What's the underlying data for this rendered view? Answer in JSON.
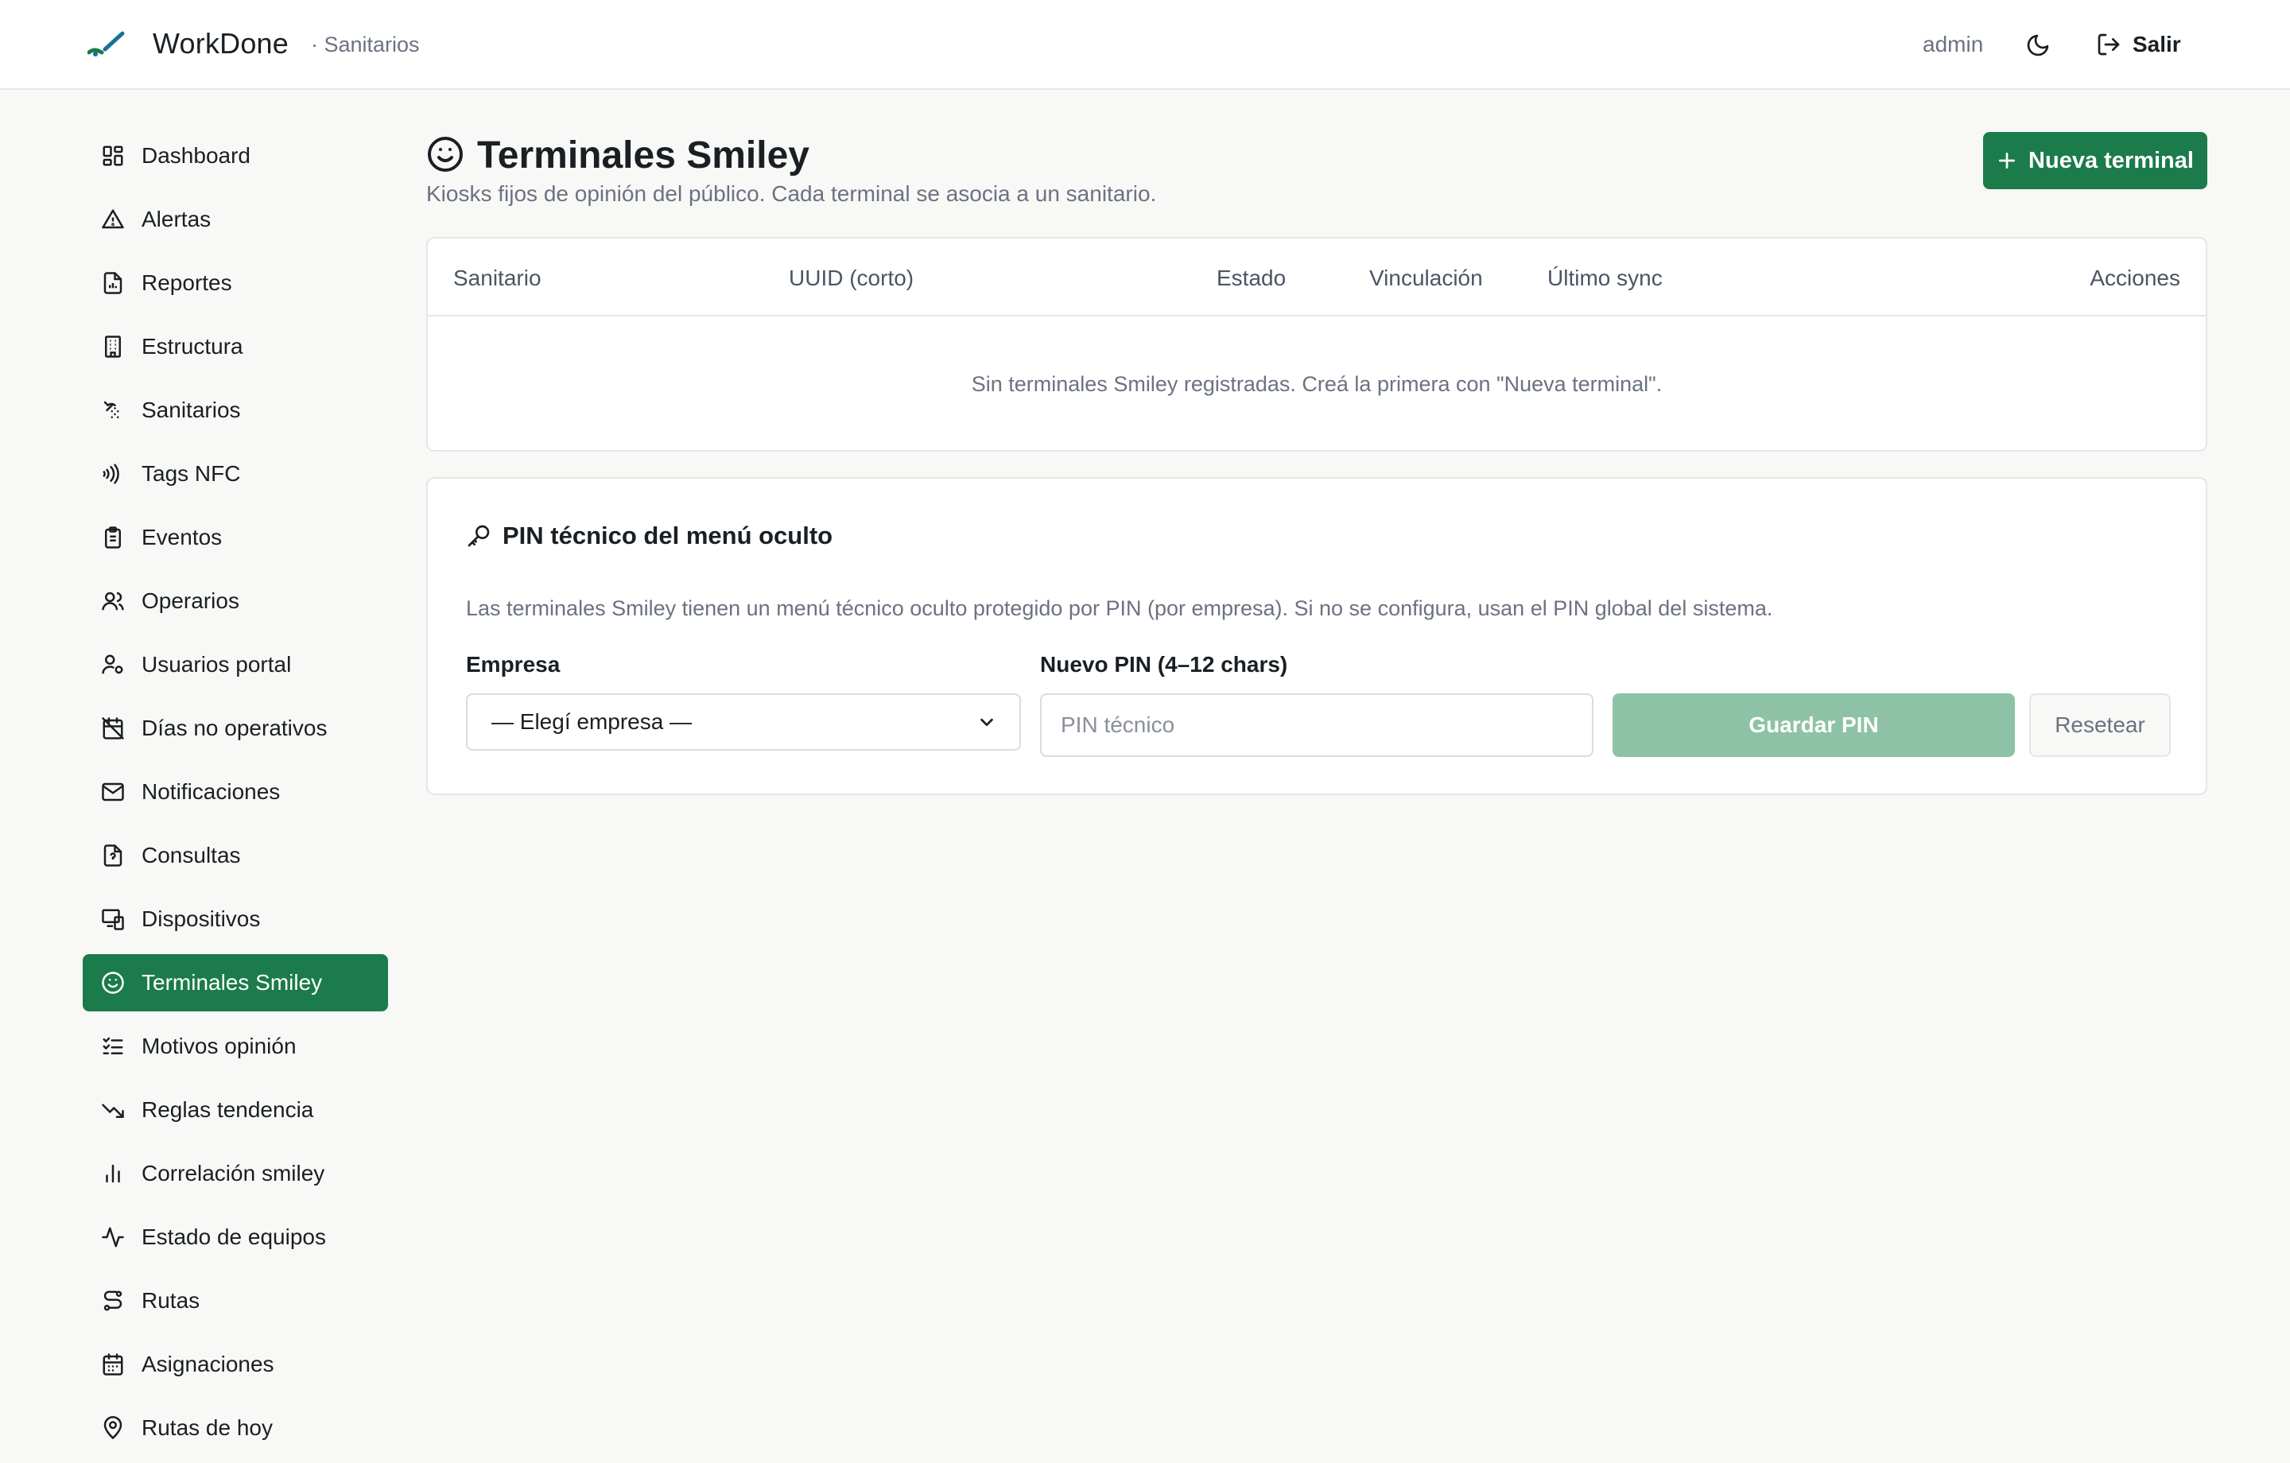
{
  "header": {
    "app_name": "WorkDone",
    "section": "· Sanitarios",
    "user": "admin",
    "theme_icon": "moon-icon",
    "logout_label": "Salir",
    "accent": "#1b7b4b"
  },
  "sidebar": {
    "active_index": 13,
    "items": [
      {
        "label": "Dashboard",
        "icon": "grid-icon"
      },
      {
        "label": "Alertas",
        "icon": "warning-icon"
      },
      {
        "label": "Reportes",
        "icon": "report-icon"
      },
      {
        "label": "Estructura",
        "icon": "building-icon"
      },
      {
        "label": "Sanitarios",
        "icon": "shower-icon"
      },
      {
        "label": "Tags NFC",
        "icon": "nfc-icon"
      },
      {
        "label": "Eventos",
        "icon": "clipboard-icon"
      },
      {
        "label": "Operarios",
        "icon": "users-icon"
      },
      {
        "label": "Usuarios portal",
        "icon": "user-key-icon"
      },
      {
        "label": "Días no operativos",
        "icon": "calendar-off-icon"
      },
      {
        "label": "Notificaciones",
        "icon": "mail-icon"
      },
      {
        "label": "Consultas",
        "icon": "file-question-icon"
      },
      {
        "label": "Dispositivos",
        "icon": "devices-icon"
      },
      {
        "label": "Terminales Smiley",
        "icon": "smiley-icon"
      },
      {
        "label": "Motivos opinión",
        "icon": "list-check-icon"
      },
      {
        "label": "Reglas tendencia",
        "icon": "trend-down-icon"
      },
      {
        "label": "Correlación smiley",
        "icon": "bar-chart-icon"
      },
      {
        "label": "Estado de equipos",
        "icon": "activity-icon"
      },
      {
        "label": "Rutas",
        "icon": "route-icon"
      },
      {
        "label": "Asignaciones",
        "icon": "calendar-icon"
      },
      {
        "label": "Rutas de hoy",
        "icon": "map-pin-icon"
      }
    ]
  },
  "main": {
    "title": "Terminales Smiley",
    "subtitle": "Kiosks fijos de opinión del público. Cada terminal se asocia a un sanitario.",
    "new_button": "Nueva terminal",
    "table": {
      "columns": [
        "Sanitario",
        "UUID (corto)",
        "Estado",
        "Vinculación",
        "Último sync",
        "Acciones"
      ],
      "empty_message": "Sin terminales Smiley registradas. Creá la primera con \"Nueva terminal\"."
    },
    "pin_section": {
      "title": "PIN técnico del menú oculto",
      "description": "Las terminales Smiley tienen un menú técnico oculto protegido por PIN (por empresa). Si no se configura, usan el PIN global del sistema.",
      "empresa_label": "Empresa",
      "empresa_selected": "— Elegí empresa —",
      "pin_label": "Nuevo PIN (4–12 chars)",
      "pin_placeholder": "PIN técnico",
      "save_button": "Guardar PIN",
      "reset_button": "Resetear"
    }
  }
}
